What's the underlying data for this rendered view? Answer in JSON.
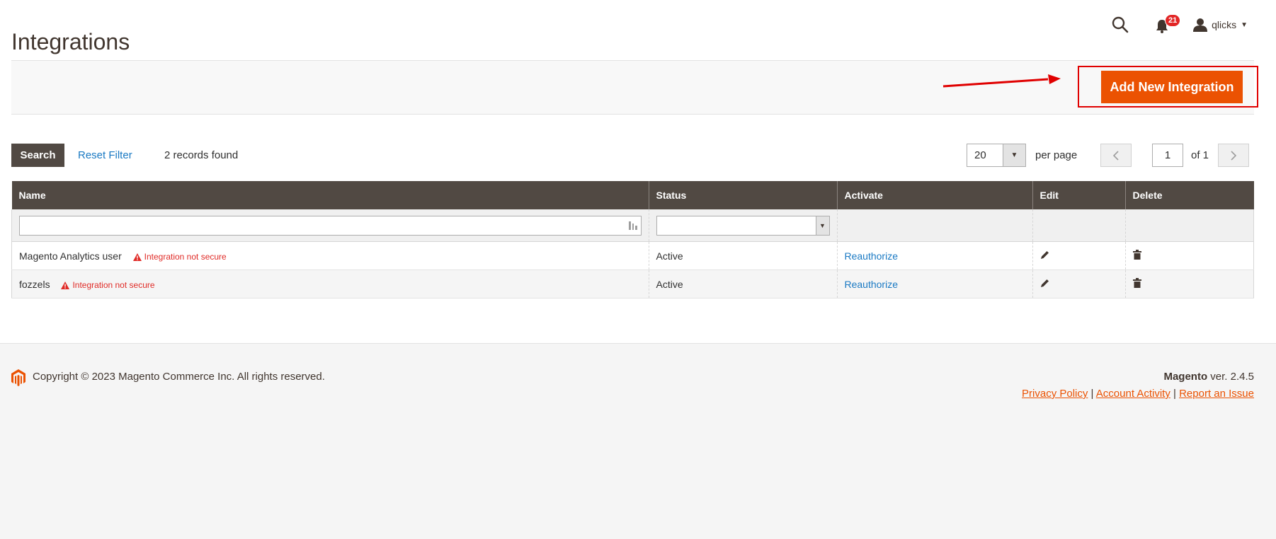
{
  "header": {
    "title": "Integrations",
    "notifications_count": "21",
    "user_name": "qlicks"
  },
  "actions": {
    "add_button": "Add New Integration"
  },
  "toolbar": {
    "search_label": "Search",
    "reset_label": "Reset Filter",
    "records_text": "2 records found",
    "per_page_value": "20",
    "per_page_label": "per page",
    "page_number": "1",
    "page_of": "of 1"
  },
  "grid": {
    "columns": [
      "Name",
      "Status",
      "Activate",
      "Edit",
      "Delete"
    ],
    "rows": [
      {
        "name": "Magento Analytics user",
        "warning": "Integration not secure",
        "status": "Active",
        "activate": "Reauthorize"
      },
      {
        "name": "fozzels",
        "warning": "Integration not secure",
        "status": "Active",
        "activate": "Reauthorize"
      }
    ]
  },
  "footer": {
    "copyright": "Copyright © 2023 Magento Commerce Inc. All rights reserved.",
    "brand": "Magento",
    "version": " ver. 2.4.5",
    "links": [
      "Privacy Policy",
      "Account Activity",
      "Report an Issue"
    ],
    "separator": "|"
  },
  "colors": {
    "accent": "#eb5202",
    "header_bg": "#514943",
    "link": "#1979c3",
    "warning": "#e02b27",
    "annotation": "#e00000"
  }
}
